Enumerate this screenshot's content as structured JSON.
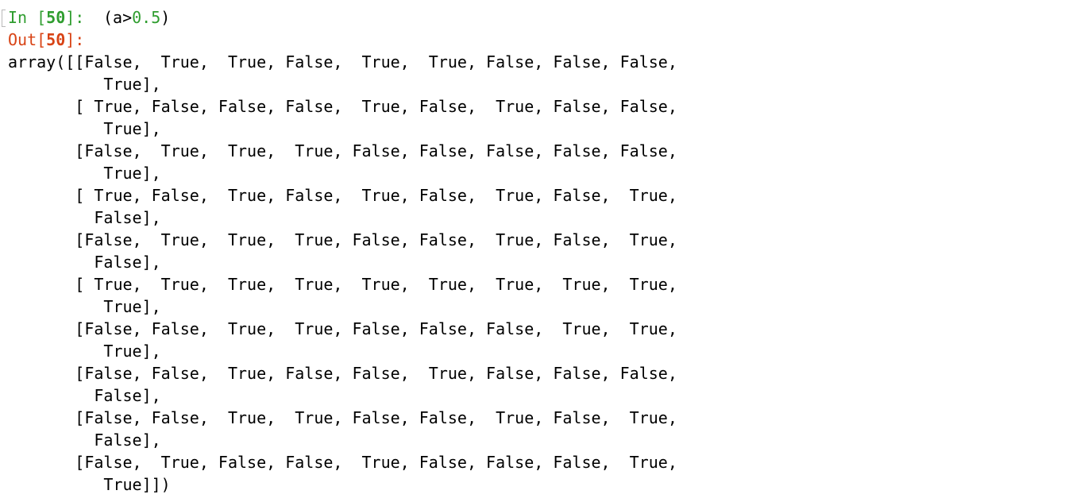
{
  "input_cell": {
    "prompt_prefix": "In [",
    "prompt_number": "50",
    "prompt_suffix": "]:",
    "code_before_number": "(a>",
    "code_number": "0.5",
    "code_after_number": ")"
  },
  "output_cell": {
    "prompt_prefix": "Out[",
    "prompt_number": "50",
    "prompt_suffix": "]:",
    "lines": [
      "array([[False,  True,  True, False,  True,  True, False, False, False,",
      "          True],",
      "       [ True, False, False, False,  True, False,  True, False, False,",
      "          True],",
      "       [False,  True,  True,  True, False, False, False, False, False,",
      "          True],",
      "       [ True, False,  True, False,  True, False,  True, False,  True,",
      "         False],",
      "       [False,  True,  True,  True, False, False,  True, False,  True,",
      "         False],",
      "       [ True,  True,  True,  True,  True,  True,  True,  True,  True,",
      "          True],",
      "       [False, False,  True,  True, False, False, False,  True,  True,",
      "          True],",
      "       [False, False,  True, False, False,  True, False, False, False,",
      "         False],",
      "       [False, False,  True,  True, False, False,  True, False,  True,",
      "         False],",
      "       [False,  True, False, False,  True, False, False, False,  True,",
      "          True]])"
    ]
  },
  "colors": {
    "in_prompt": "#2f9d2f",
    "out_prompt": "#d84315",
    "number_literal": "#2f9d2f",
    "text": "#000000",
    "background": "#ffffff"
  }
}
